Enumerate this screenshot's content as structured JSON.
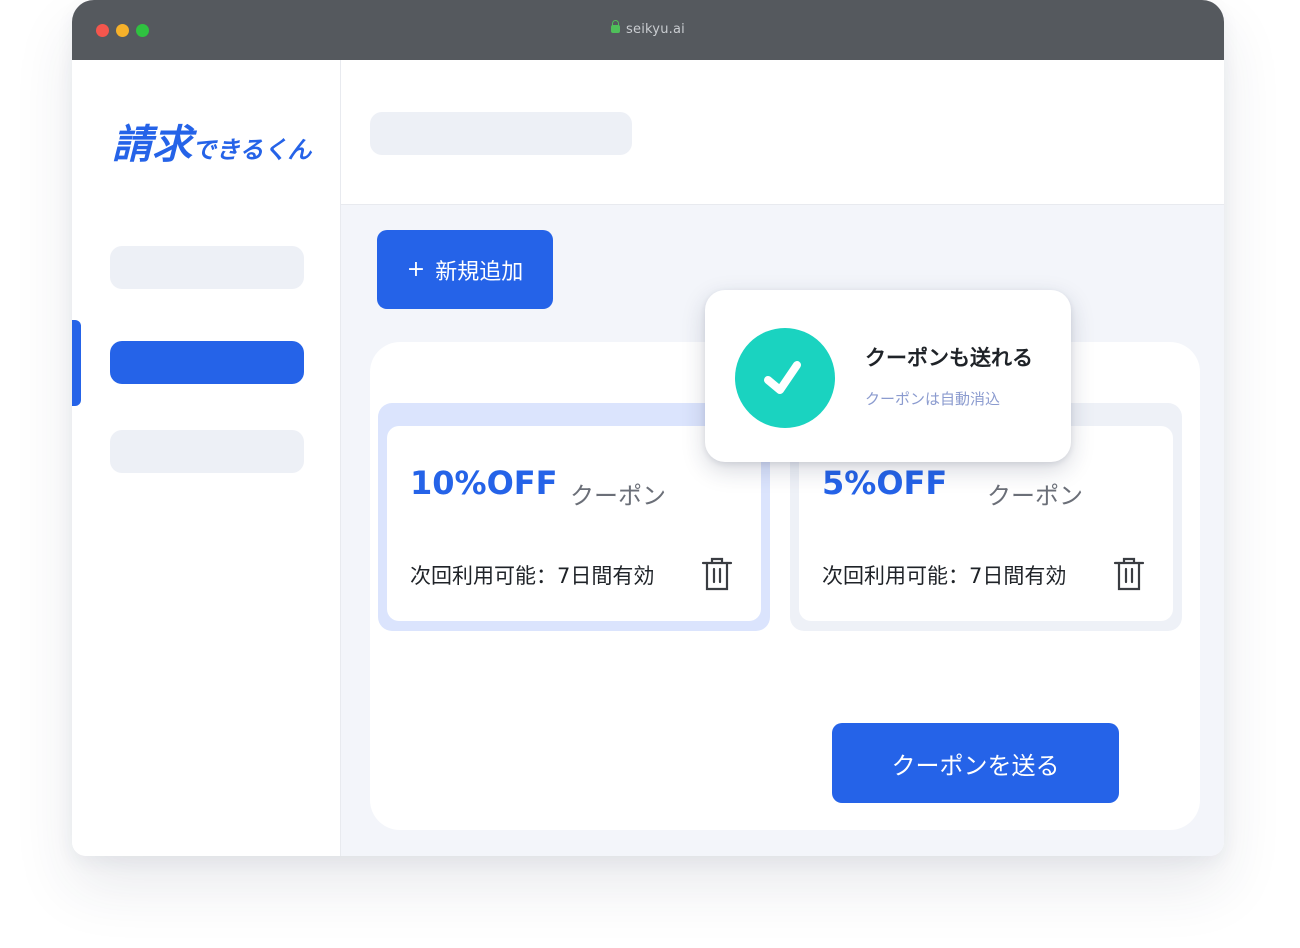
{
  "browser": {
    "url": "seikyu.ai"
  },
  "sidebar": {
    "logo_main": "請求",
    "logo_sub": "できるくん"
  },
  "actions": {
    "add_label": "新規追加",
    "add_icon": "plus-icon",
    "send_label": "クーポンを送る"
  },
  "coupons": [
    {
      "title": "10%OFF",
      "type": "クーポン",
      "validity": "次回利用可能：7日間有効",
      "selected": true
    },
    {
      "title": "5%OFF",
      "type": "クーポン",
      "validity": "次回利用可能：7日間有効",
      "selected": false
    }
  ],
  "toast": {
    "title": "クーポンも送れる",
    "subtitle": "クーポンは自動消込",
    "icon": "check-icon"
  },
  "colors": {
    "brand": "#2563e8",
    "success": "#1ad3c0",
    "titlebar": "#55595e"
  }
}
